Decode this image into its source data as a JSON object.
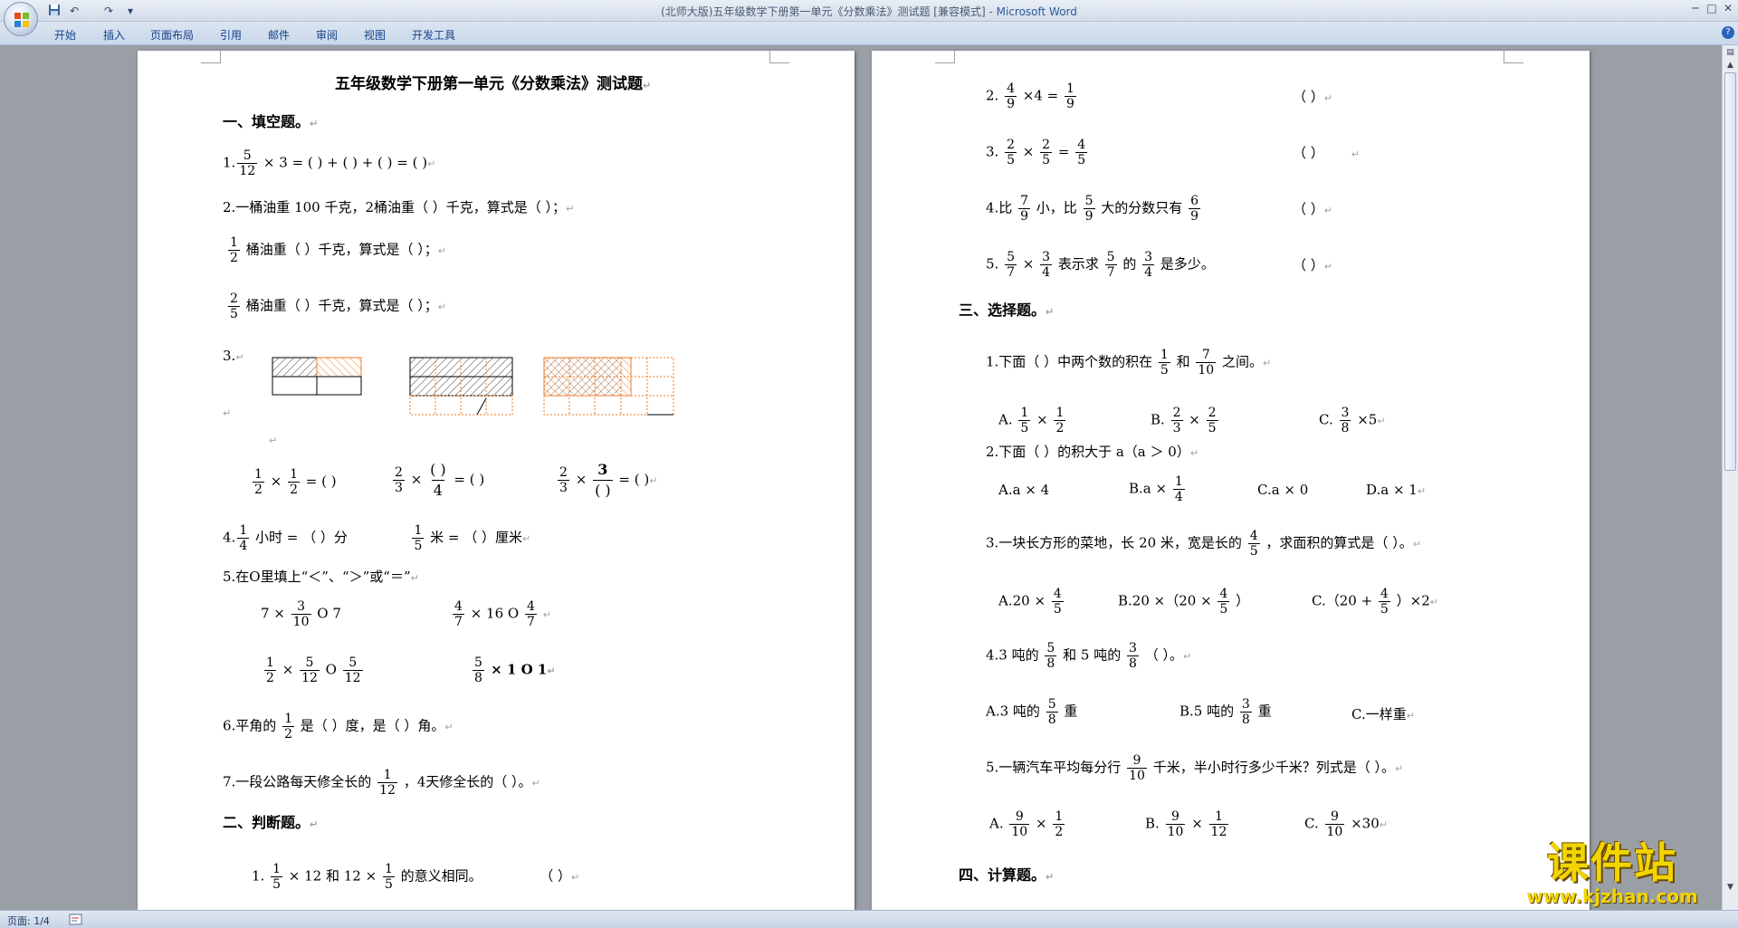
{
  "window": {
    "title_doc": "(北师大版)五年级数学下册第一单元《分数乘法》测试题 [兼容模式] - ",
    "title_app": "Microsoft Word",
    "qa_undo": "↶",
    "qa_redo": "↷",
    "qa_more": "▾",
    "min": "─",
    "max": "□",
    "close": "✕"
  },
  "ribbon": {
    "tabs": [
      "开始",
      "插入",
      "页面布局",
      "引用",
      "邮件",
      "审阅",
      "视图",
      "开发工具"
    ],
    "help": "?"
  },
  "status": {
    "page": "页面: 1/4"
  },
  "watermark": {
    "big": "课件站",
    "url": "www.kjzhan.com"
  },
  "page1": {
    "title": "五年级数学下册第一单元《分数乘法》测试题",
    "sec1": "一、填空题。",
    "q1_prefix": "1.",
    "q1_rest": "× 3 = ( ) + ( ) + ( ) = ( )",
    "q2": "2.一桶油重 100 千克，2桶油重（ ）千克，算式是（ ）；",
    "q2b": "桶油重（ ）千克，算式是（ ）；",
    "q2c": "桶油重（ ）千克，算式是（ ）；",
    "q3": "3.",
    "q3_eq1": "= ( )",
    "q3_eq2": "= ( )",
    "q3_eq3": "= ( )",
    "q3_blank": "( )",
    "q4_a": "4.",
    "q4_b": "小时 = （ ）分",
    "q4_c": "米 = （ ）厘米",
    "q5": "5.在O里填上“＜”、“＞”或“＝”",
    "q5_a": "7 ×",
    "q5_a2": "O 7",
    "q5_b": "× 16 O",
    "q5_c": "×",
    "q5_c2": "O",
    "q5_d": "× 1 O 1",
    "q6_a": "6.平角的",
    "q6_b": "是（ ）度，是（ ）角。",
    "q7_a": "7.一段公路每天修全长的",
    "q7_b": "，4天修全长的（ ）。",
    "sec2": "二、判断题。",
    "j1_a": "1.",
    "j1_b": "× 12 和 12 ×",
    "j1_c": "的意义相同。",
    "j1_paren": "（ ）",
    "times": "×",
    "one": "1",
    "two": "2",
    "three": "3",
    "four": "4",
    "five": "5",
    "seven": "7",
    "eight": "8",
    "ten": "10",
    "twelve": "12"
  },
  "page2": {
    "j2": "2.",
    "j2_mid": "×4 =",
    "j3": "3.",
    "j3_mid": "=",
    "j4_a": "4.比",
    "j4_b": "小，比",
    "j4_c": "大的分数只有",
    "j5_a": "5.",
    "j5_b": "表示求",
    "j5_c": "的",
    "j5_d": "是多少。",
    "paren": "（ ）",
    "sec3": "三、选择题。",
    "c1_a": "1.下面（ ）中两个数的积在",
    "c1_b": "和",
    "c1_c": "之间。",
    "c1_A": "A.",
    "c1_B": "B.",
    "c1_C": "C.",
    "c1_C2": "×5",
    "c2": "2.下面（ ）的积大于 a（a ＞ 0）",
    "c2_A": "A.a × 4",
    "c2_B": "B.a ×",
    "c2_C": "C.a × 0",
    "c2_D": "D.a × 1",
    "c3_a": "3.一块长方形的菜地，长 20 米，宽是长的",
    "c3_b": "，求面积的算式是（ ）。",
    "c3_A": "A.20 ×",
    "c3_B": "B.20 ×（20 ×",
    "c3_B2": "）",
    "c3_C": "C.（20 +",
    "c3_C2": "）×2",
    "c4_a": "4.3 吨的",
    "c4_b": "和 5 吨的",
    "c4_c": "（ ）。",
    "c4_A": "A.3 吨的",
    "c4_A2": "重",
    "c4_B": "B.5 吨的",
    "c4_B2": "重",
    "c4_C": "C.一样重",
    "c5_a": "5.一辆汽车平均每分行",
    "c5_b": "千米，半小时行多少千米？列式是（ ）。",
    "c5_A": "A.",
    "c5_B": "B.",
    "c5_C": "C.",
    "c5_C2": "×30",
    "sec4": "四、计算题。",
    "times": "×",
    "n1": "1",
    "n2": "2",
    "n3": "3",
    "n4": "4",
    "n5": "5",
    "n6": "6",
    "n7": "7",
    "n8": "8",
    "n9": "9",
    "n10": "10",
    "n12": "12"
  },
  "mark": "↵",
  "icons": {
    "office": "office-logo-icon",
    "save": "save-icon"
  }
}
